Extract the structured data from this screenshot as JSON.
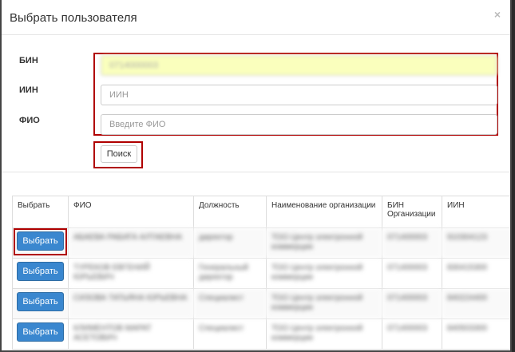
{
  "modal": {
    "title": "Выбрать пользователя",
    "close": "×"
  },
  "form": {
    "bin_label": "БИН",
    "iin_label": "ИИН",
    "fio_label": "ФИО",
    "bin_value": "0714000003",
    "iin_placeholder": "ИИН",
    "fio_placeholder": "Введите ФИО",
    "search_label": "Поиск"
  },
  "table": {
    "headers": [
      "Выбрать",
      "ФИО",
      "Должность",
      "Наименование организации",
      "БИН Организации",
      "ИИН"
    ],
    "select_label": "Выбрать",
    "rows": [
      {
        "fio": "АБАЕВА РАБИГА АЛТАЕВНА",
        "position": "директор",
        "org": "ТОО Центр электронной коммерции",
        "bin": "071400003",
        "iin": "910304123"
      },
      {
        "fio": "ТУРЕКОВ ЕВГЕНИЙ ЮРЬЕВИЧ",
        "position": "Генеральный директор",
        "org": "ТОО Центр электронной коммерции",
        "bin": "071400003",
        "iin": "830415300"
      },
      {
        "fio": "СИЗОВА ТАТЬЯНА ЮРЬЕВНА",
        "position": "Специалист",
        "org": "ТОО Центр электронной коммерции",
        "bin": "071400003",
        "iin": "840224400"
      },
      {
        "fio": "КЛИМЕНТОВ МАРАТ АСЕТОВИЧ",
        "position": "Специалист",
        "org": "ТОО Центр электронной коммерции",
        "bin": "071400003",
        "iin": "840503300"
      }
    ]
  }
}
